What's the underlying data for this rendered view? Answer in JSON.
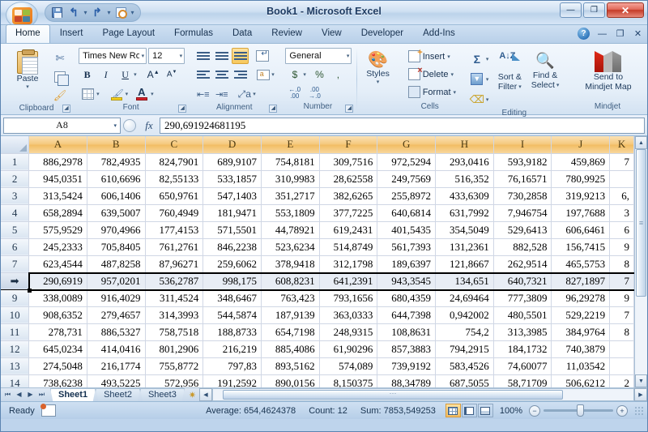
{
  "titlebar": {
    "document_title": "Book1 - Microsoft Excel",
    "qat": [
      {
        "name": "save",
        "label": "Save"
      },
      {
        "name": "undo",
        "label": "Undo"
      },
      {
        "name": "redo",
        "label": "Redo"
      },
      {
        "name": "print-preview",
        "label": "Print Preview"
      },
      {
        "name": "customize",
        "label": "Customize Quick Access Toolbar"
      }
    ],
    "window_buttons": {
      "minimize": "—",
      "restore": "❐",
      "close": "✕"
    }
  },
  "ribbon": {
    "tabs": [
      {
        "label": "Home",
        "active": true
      },
      {
        "label": "Insert",
        "active": false
      },
      {
        "label": "Page Layout",
        "active": false
      },
      {
        "label": "Formulas",
        "active": false
      },
      {
        "label": "Data",
        "active": false
      },
      {
        "label": "Review",
        "active": false
      },
      {
        "label": "View",
        "active": false
      },
      {
        "label": "Developer",
        "active": false
      },
      {
        "label": "Add-Ins",
        "active": false
      }
    ],
    "tab_right": {
      "help": "?",
      "minimize_ribbon": "—",
      "restore_window": "❐",
      "close_window": "✕"
    },
    "groups": {
      "clipboard": {
        "label": "Clipboard",
        "paste": "Paste",
        "cut": "Cut",
        "copy": "Copy",
        "format_painter": "Format Painter"
      },
      "font": {
        "label": "Font",
        "font_name": "Times New Ro",
        "font_size": "12",
        "bold": "B",
        "italic": "I",
        "underline": "U",
        "grow_font": "A",
        "shrink_font": "A",
        "borders": "Borders",
        "fill_color": "Fill Color",
        "font_color": "A"
      },
      "alignment": {
        "label": "Alignment",
        "top_align": "Top Align",
        "middle_align": "Middle Align",
        "bottom_align": "Bottom Align",
        "align_left": "Align Text Left",
        "center": "Center",
        "align_right": "Align Text Right",
        "decrease_indent": "Decrease Indent",
        "increase_indent": "Increase Indent",
        "orientation": "Orientation",
        "wrap_text": "Wrap Text",
        "merge_center": "Merge & Center"
      },
      "number": {
        "label": "Number",
        "format": "General",
        "accounting": "$",
        "percent": "%",
        "comma": ",",
        "increase_decimal": "Increase Decimal",
        "decrease_decimal": "Decrease Decimal"
      },
      "styles": {
        "label": "Styles",
        "button": "Styles"
      },
      "cells": {
        "label": "Cells",
        "insert": "Insert",
        "delete": "Delete",
        "format": "Format"
      },
      "editing": {
        "label": "Editing",
        "autosum": "Σ",
        "fill": "Fill",
        "clear": "Clear",
        "sort_filter": "Sort &\nFilter",
        "sort_filter_l1": "Sort &",
        "sort_filter_l2": "Filter",
        "find_select_l1": "Find &",
        "find_select_l2": "Select"
      },
      "mindjet": {
        "label": "Mindjet",
        "send_l1": "Send to",
        "send_l2": "Mindjet Map"
      }
    }
  },
  "formula_bar": {
    "name_box": "A8",
    "fx": "fx",
    "content": "290,691924681195"
  },
  "grid": {
    "columns": [
      "A",
      "B",
      "C",
      "D",
      "E",
      "F",
      "G",
      "H",
      "I",
      "J",
      "K"
    ],
    "row_numbers": [
      "1",
      "2",
      "3",
      "4",
      "5",
      "6",
      "7",
      "8",
      "9",
      "10",
      "11",
      "12",
      "13",
      "14"
    ],
    "selected_row_index": 7,
    "selected_row_marker": "➡",
    "rows": [
      [
        "886,2978",
        "782,4935",
        "824,7901",
        "689,9107",
        "754,8181",
        "309,7516",
        "972,5294",
        "293,0416",
        "593,9182",
        "459,869",
        "7"
      ],
      [
        "945,0351",
        "610,6696",
        "82,55133",
        "533,1857",
        "310,9983",
        "28,62558",
        "249,7569",
        "516,352",
        "76,16571",
        "780,9925",
        ""
      ],
      [
        "313,5424",
        "606,1406",
        "650,9761",
        "547,1403",
        "351,2717",
        "382,6265",
        "255,8972",
        "433,6309",
        "730,2858",
        "319,9213",
        "6,"
      ],
      [
        "658,2894",
        "639,5007",
        "760,4949",
        "181,9471",
        "553,1809",
        "377,7225",
        "640,6814",
        "631,7992",
        "7,946754",
        "197,7688",
        "3"
      ],
      [
        "575,9529",
        "970,4966",
        "177,4153",
        "571,5501",
        "44,78921",
        "619,2431",
        "401,5435",
        "354,5049",
        "529,6413",
        "606,6461",
        "6"
      ],
      [
        "245,2333",
        "705,8405",
        "761,2761",
        "846,2238",
        "523,6234",
        "514,8749",
        "561,7393",
        "131,2361",
        "882,528",
        "156,7415",
        "9"
      ],
      [
        "623,4544",
        "487,8258",
        "87,96271",
        "259,6062",
        "378,9418",
        "312,1798",
        "189,6397",
        "121,8667",
        "262,9514",
        "465,5753",
        "8"
      ],
      [
        "290,6919",
        "957,0201",
        "536,2787",
        "998,175",
        "608,8231",
        "641,2391",
        "943,3545",
        "134,651",
        "640,7321",
        "827,1897",
        "7"
      ],
      [
        "338,0089",
        "916,4029",
        "311,4524",
        "348,6467",
        "763,423",
        "793,1656",
        "680,4359",
        "24,69464",
        "777,3809",
        "96,29278",
        "9"
      ],
      [
        "908,6352",
        "279,4657",
        "314,3993",
        "544,5874",
        "187,9139",
        "363,0333",
        "644,7398",
        "0,942002",
        "480,5501",
        "529,2219",
        "7"
      ],
      [
        "278,731",
        "886,5327",
        "758,7518",
        "188,8733",
        "654,7198",
        "248,9315",
        "108,8631",
        "754,2",
        "313,3985",
        "384,9764",
        "8"
      ],
      [
        "645,0234",
        "414,0416",
        "801,2906",
        "216,219",
        "885,4086",
        "61,90296",
        "857,3883",
        "794,2915",
        "184,1732",
        "740,3879",
        ""
      ],
      [
        "274,5048",
        "216,1774",
        "755,8772",
        "797,83",
        "893,5162",
        "574,089",
        "739,9192",
        "583,4526",
        "74,60077",
        "11,03542",
        ""
      ],
      [
        "738,6238",
        "493,5225",
        "572,956",
        "191,2592",
        "890,0156",
        "8,150375",
        "88,34789",
        "687,5055",
        "58,71709",
        "506,6212",
        "2"
      ]
    ]
  },
  "sheet_tabs": {
    "nav": [
      "⏮",
      "◀",
      "▶",
      "⏭"
    ],
    "tabs": [
      {
        "label": "Sheet1",
        "active": true
      },
      {
        "label": "Sheet2",
        "active": false
      },
      {
        "label": "Sheet3",
        "active": false
      }
    ],
    "insert_sheet": "✷"
  },
  "status_bar": {
    "mode": "Ready",
    "macro_record": "Record Macro",
    "average": "Average: 654,4624378",
    "count": "Count: 12",
    "sum": "Sum: 7853,549253",
    "views": [
      {
        "name": "normal",
        "active": true
      },
      {
        "name": "page-layout",
        "active": false
      },
      {
        "name": "page-break-preview",
        "active": false
      }
    ],
    "zoom": "100%",
    "zoom_out": "−",
    "zoom_in": "+"
  },
  "colors": {
    "header_orange": "#f2bd63",
    "ribbon_blue": "#d3e2f2",
    "selection_band": "#000000",
    "accent": "#2f5c8f"
  }
}
